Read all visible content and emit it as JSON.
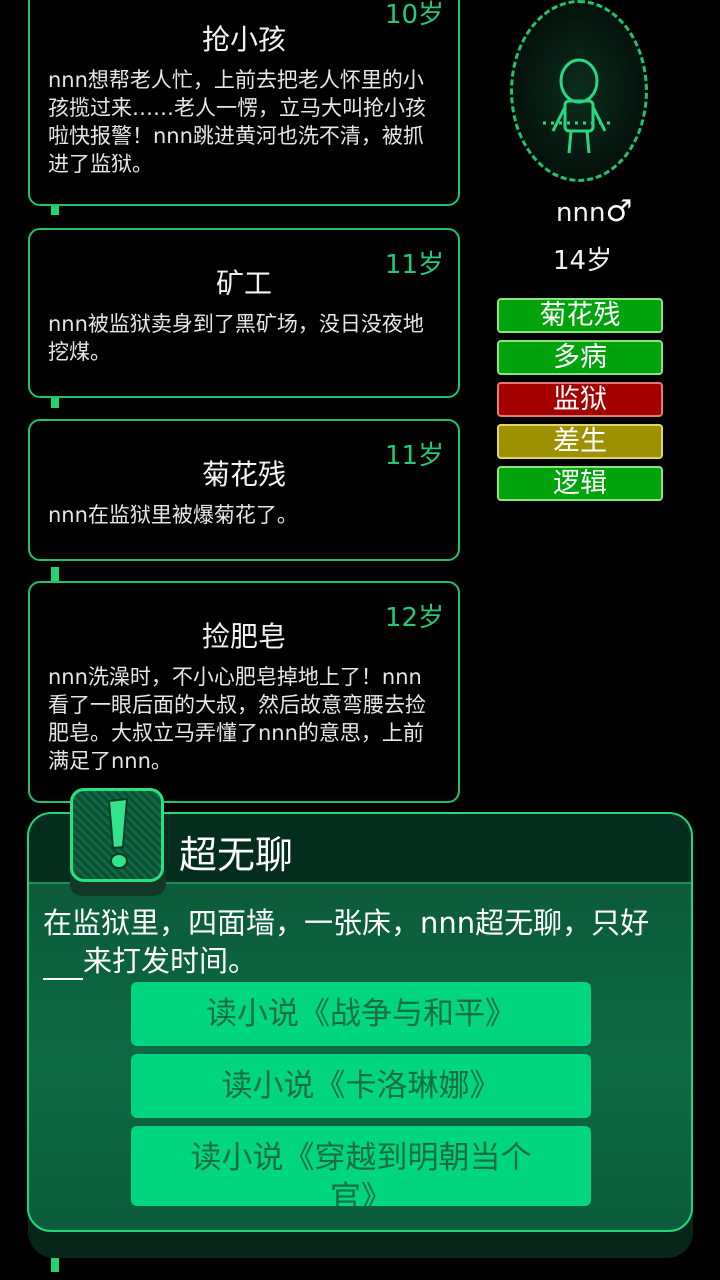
{
  "events": [
    {
      "age": "10岁",
      "title": "抢小孩",
      "body": "nnn想帮老人忙，上前去把老人怀里的小孩揽过来……老人一愣，立马大叫抢小孩啦快报警！nnn跳进黄河也洗不清，被抓进了监狱。"
    },
    {
      "age": "11岁",
      "title": "矿工",
      "body": "nnn被监狱卖身到了黑矿场，没日没夜地挖煤。"
    },
    {
      "age": "11岁",
      "title": "菊花残",
      "body": "nnn在监狱里被爆菊花了。"
    },
    {
      "age": "12岁",
      "title": "捡肥皂",
      "body": "nnn洗澡时，不小心肥皂掉地上了！nnn看了一眼后面的大叔，然后故意弯腰去捡肥皂。大叔立马弄懂了nnn的意思，上前满足了nnn。"
    }
  ],
  "player": {
    "name": "nnn",
    "gender_icon": "male-icon",
    "age": "14岁"
  },
  "traits": [
    {
      "label": "菊花残",
      "color": "#00a30b"
    },
    {
      "label": "多病",
      "color": "#00a30b"
    },
    {
      "label": "监狱",
      "color": "#a40000"
    },
    {
      "label": "差生",
      "color": "#9c9100"
    },
    {
      "label": "逻辑",
      "color": "#00a30b"
    }
  ],
  "dialog": {
    "title": "超无聊",
    "text_before_blank": "在监狱里，四面墙，一张床，nnn超无聊，只好",
    "text_after_blank": "来打发时间。",
    "choices": [
      "读小说《战争与和平》",
      "读小说《卡洛琳娜》",
      "读小说《穿越到明朝当个官》"
    ]
  },
  "colors": {
    "accent": "#22d36f",
    "choice_bg": "#00d57f",
    "choice_text": "#1a6e45",
    "dialog_bg": "#0c5c3b"
  }
}
